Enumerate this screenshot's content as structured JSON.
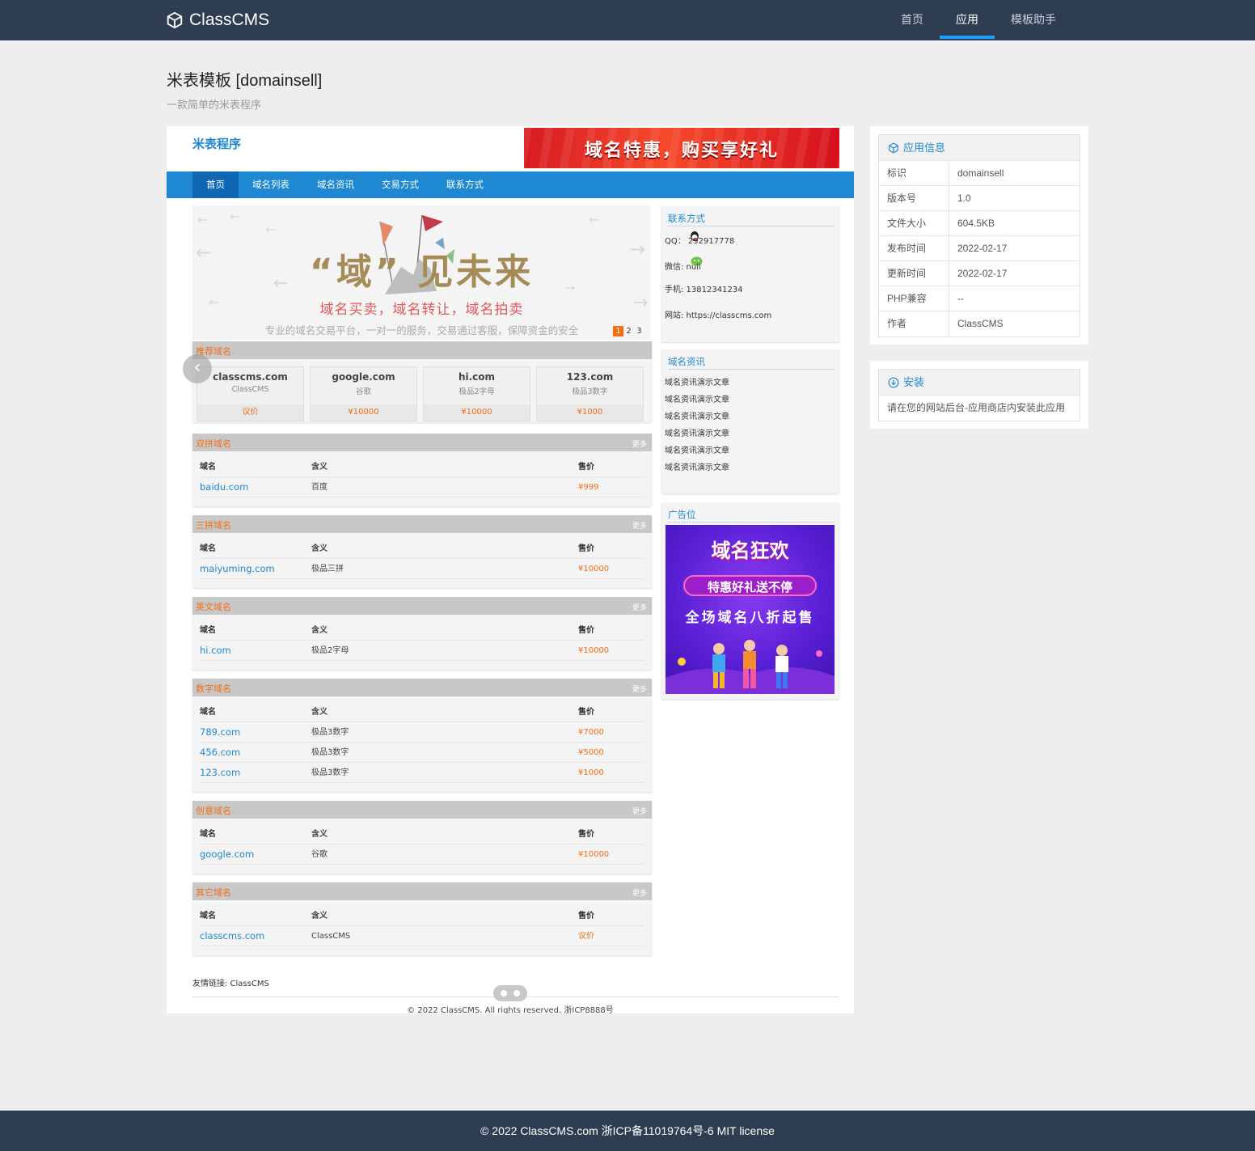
{
  "topnav": {
    "brand": "ClassCMS",
    "items": [
      {
        "label": "首页",
        "active": false
      },
      {
        "label": "应用",
        "active": true
      },
      {
        "label": "模板助手",
        "active": false
      }
    ]
  },
  "page": {
    "title": "米表模板 [domainsell]",
    "subtitle": "一款简单的米表程序"
  },
  "preview": {
    "site_name": "米表程序",
    "banner_text": "域名特惠，购买享好礼",
    "menu": [
      "首页",
      "域名列表",
      "域名资讯",
      "交易方式",
      "联系方式"
    ],
    "slider": {
      "headline": "“域”  见未来",
      "line1": "域名买卖，域名转让，域名拍卖",
      "line2": "专业的域名交易平台，一对一的服务，交易通过客服，保障资金的安全",
      "dots": [
        "1",
        "2",
        "3"
      ]
    },
    "recommend": {
      "title": "推荐域名",
      "items": [
        {
          "name": "classcms.com",
          "desc": "ClassCMS",
          "price": "议价"
        },
        {
          "name": "google.com",
          "desc": "谷歌",
          "price": "¥10000"
        },
        {
          "name": "hi.com",
          "desc": "极品2字母",
          "price": "¥10000"
        },
        {
          "name": "123.com",
          "desc": "极品3数字",
          "price": "¥1000"
        }
      ]
    },
    "columns": {
      "domain": "域名",
      "meaning": "含义",
      "price": "售价"
    },
    "more_label": "更多",
    "sections": [
      {
        "title": "双拼域名",
        "rows": [
          {
            "domain": "baidu.com",
            "meaning": "百度",
            "price": "¥999"
          }
        ]
      },
      {
        "title": "三拼域名",
        "rows": [
          {
            "domain": "maiyuming.com",
            "meaning": "极品三拼",
            "price": "¥10000"
          }
        ]
      },
      {
        "title": "英文域名",
        "rows": [
          {
            "domain": "hi.com",
            "meaning": "极品2字母",
            "price": "¥10000"
          }
        ]
      },
      {
        "title": "数字域名",
        "rows": [
          {
            "domain": "789.com",
            "meaning": "极品3数字",
            "price": "¥7000"
          },
          {
            "domain": "456.com",
            "meaning": "极品3数字",
            "price": "¥5000"
          },
          {
            "domain": "123.com",
            "meaning": "极品3数字",
            "price": "¥1000"
          }
        ]
      },
      {
        "title": "创意域名",
        "rows": [
          {
            "domain": "google.com",
            "meaning": "谷歌",
            "price": "¥10000"
          }
        ]
      },
      {
        "title": "其它域名",
        "rows": [
          {
            "domain": "classcms.com",
            "meaning": "ClassCMS",
            "price": "议价"
          }
        ]
      }
    ],
    "contact": {
      "title": "联系方式",
      "qq": "QQ：  292917778",
      "wechat": "微信:       null",
      "phone": "手机:  13812341234",
      "website": "网站:  https://classcms.com"
    },
    "news": {
      "title": "域名资讯",
      "items": [
        "域名资讯演示文章",
        "域名资讯演示文章",
        "域名资讯演示文章",
        "域名资讯演示文章",
        "域名资讯演示文章",
        "域名资讯演示文章"
      ]
    },
    "ad": {
      "title": "广告位",
      "line1": "域名狂欢",
      "line2": "特惠好礼送不停",
      "line3": "全场域名八折起售"
    },
    "links": "友情链接:  ClassCMS",
    "copyright": "© 2022 ClassCMS. All rights reserved. 浙ICP8888号"
  },
  "app_info": {
    "title": "应用信息",
    "rows": [
      {
        "k": "标识",
        "v": "domainsell"
      },
      {
        "k": "版本号",
        "v": "1.0"
      },
      {
        "k": "文件大小",
        "v": "604.5KB"
      },
      {
        "k": "发布时间",
        "v": "2022-02-17"
      },
      {
        "k": "更新时间",
        "v": "2022-02-17"
      },
      {
        "k": "PHP兼容",
        "v": "--"
      },
      {
        "k": "作者",
        "v": "ClassCMS"
      }
    ]
  },
  "install": {
    "title": "安装",
    "text": "请在您的网站后台-应用商店内安装此应用"
  },
  "footer": "© 2022 ClassCMS.com 浙ICP备11019764号-6 MIT license",
  "colors": {
    "nav_bg": "#2f3d52",
    "accent": "#1e9fff",
    "site_blue": "#1e88d2",
    "price_orange": "#f46d12"
  }
}
